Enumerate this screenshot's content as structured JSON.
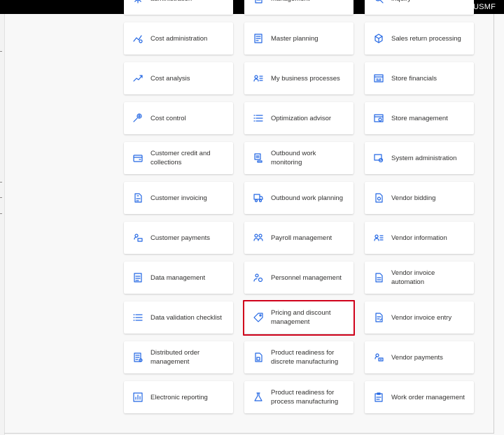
{
  "company": "USMF",
  "accent_color": "#2266e3",
  "highlight_color": "#d0021b",
  "tiles": [
    {
      "label": "administration",
      "icon": "gear-icon"
    },
    {
      "label": "management",
      "icon": "document-icon"
    },
    {
      "label": "inquiry",
      "icon": "search-icon"
    },
    {
      "label": "Cost administration",
      "icon": "cost-gear-icon"
    },
    {
      "label": "Master planning",
      "icon": "planning-icon"
    },
    {
      "label": "Sales return processing",
      "icon": "box-return-icon"
    },
    {
      "label": "Cost analysis",
      "icon": "trend-chart-icon"
    },
    {
      "label": "My business processes",
      "icon": "person-list-icon"
    },
    {
      "label": "Store financials",
      "icon": "store-icon"
    },
    {
      "label": "Cost control",
      "icon": "cost-control-icon"
    },
    {
      "label": "Optimization advisor",
      "icon": "checklist-icon"
    },
    {
      "label": "Store management",
      "icon": "store-settings-icon"
    },
    {
      "label": "Customer credit and collections",
      "icon": "credit-card-icon"
    },
    {
      "label": "Outbound work monitoring",
      "icon": "truck-monitor-icon"
    },
    {
      "label": "System administration",
      "icon": "system-gear-icon"
    },
    {
      "label": "Customer invoicing",
      "icon": "invoice-icon"
    },
    {
      "label": "Outbound work planning",
      "icon": "truck-plan-icon"
    },
    {
      "label": "Vendor bidding",
      "icon": "bid-document-icon"
    },
    {
      "label": "Customer payments",
      "icon": "customer-payment-icon"
    },
    {
      "label": "Payroll management",
      "icon": "people-money-icon"
    },
    {
      "label": "Vendor information",
      "icon": "person-list-icon"
    },
    {
      "label": "Data management",
      "icon": "data-document-icon"
    },
    {
      "label": "Personnel management",
      "icon": "people-gear-icon"
    },
    {
      "label": "Vendor invoice automation",
      "icon": "invoice-automation-icon"
    },
    {
      "label": "Data validation checklist",
      "icon": "checklist-icon"
    },
    {
      "label": "Pricing and discount management",
      "icon": "price-tag-icon",
      "highlighted": true
    },
    {
      "label": "Vendor invoice entry",
      "icon": "invoice-entry-icon"
    },
    {
      "label": "Distributed order management",
      "icon": "order-document-icon"
    },
    {
      "label": "Product readiness for discrete manufacturing",
      "icon": "product-document-icon"
    },
    {
      "label": "Vendor payments",
      "icon": "vendor-payment-icon"
    },
    {
      "label": "Electronic reporting",
      "icon": "report-icon"
    },
    {
      "label": "Product readiness for process manufacturing",
      "icon": "flask-icon"
    },
    {
      "label": "Work order management",
      "icon": "clipboard-icon"
    }
  ]
}
